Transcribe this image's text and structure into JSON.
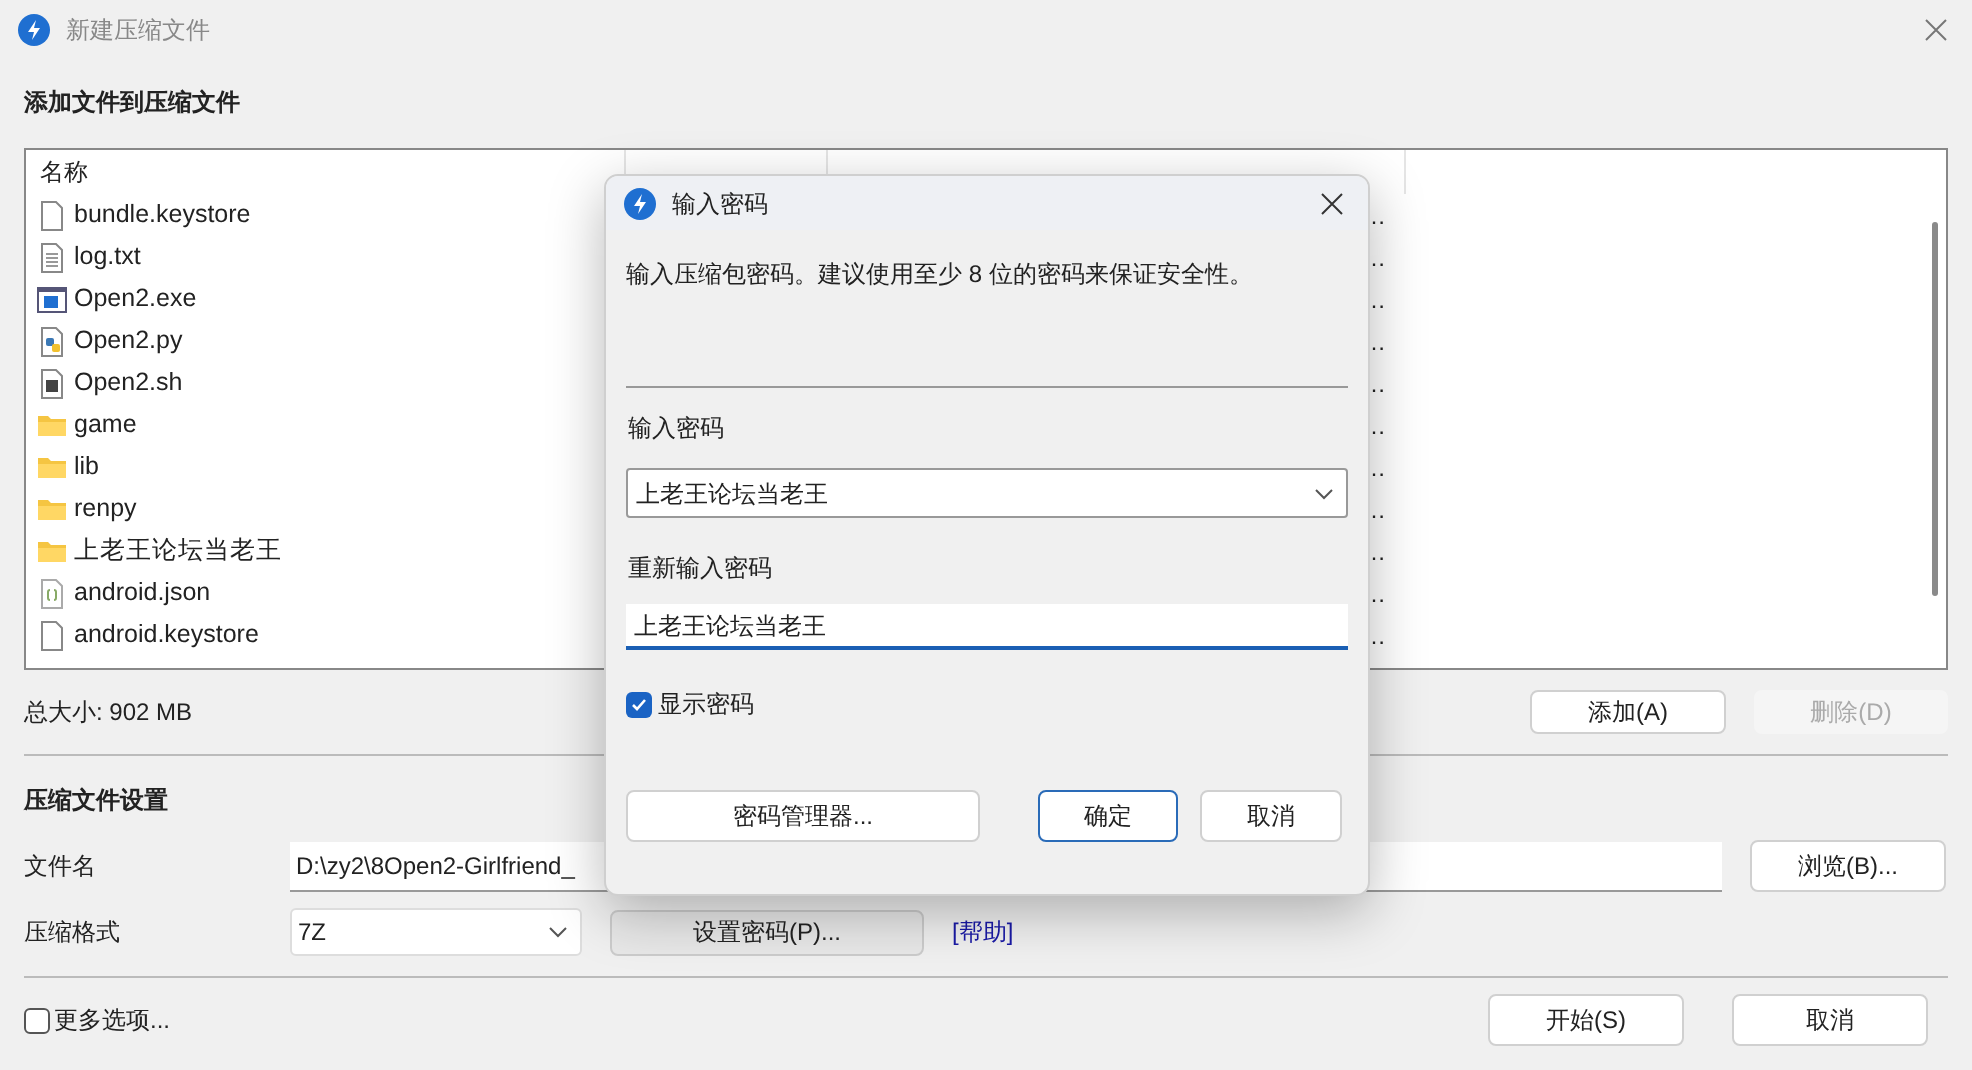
{
  "window": {
    "title": "新建压缩文件"
  },
  "section_files": {
    "title": "添加文件到压缩文件"
  },
  "file_list": {
    "columns": [
      "名称"
    ],
    "rows": [
      {
        "name": "bundle.keystore",
        "kind": "file",
        "path": "…"
      },
      {
        "name": "log.txt",
        "kind": "text",
        "path": "…"
      },
      {
        "name": "Open2.exe",
        "kind": "exe",
        "path": "…"
      },
      {
        "name": "Open2.py",
        "kind": "python",
        "path": "…"
      },
      {
        "name": "Open2.sh",
        "kind": "script",
        "path": "…"
      },
      {
        "name": "game",
        "kind": "folder",
        "path": "…"
      },
      {
        "name": "lib",
        "kind": "folder",
        "path": "…"
      },
      {
        "name": "renpy",
        "kind": "folder",
        "path": "…"
      },
      {
        "name": "上老王论坛当老王",
        "kind": "folder",
        "path": "…"
      },
      {
        "name": "android.json",
        "kind": "json",
        "path": "…"
      },
      {
        "name": "android.keystore",
        "kind": "file",
        "path": "…"
      }
    ]
  },
  "total_size": "总大小: 902 MB",
  "list_buttons": [
    {
      "label": "添加(A)",
      "disabled": false
    },
    {
      "label": "删除(D)",
      "disabled": true
    }
  ],
  "settings": {
    "title": "压缩文件设置",
    "filename_label": "文件名",
    "filename_value": "D:\\zy2\\8Open2-Girlfriend_",
    "browse_button": "浏览(B)...",
    "format_label": "压缩格式",
    "format_value": "7Z",
    "password_button": "设置密码(P)...",
    "help_link": "[帮助]"
  },
  "more_options": {
    "label": "更多选项...",
    "checked": false
  },
  "footer_buttons": [
    "开始(S)",
    "取消"
  ],
  "dialog": {
    "title": "输入密码",
    "message": "输入压缩包密码。建议使用至少 8 位的密码来保证安全性。",
    "password_label": "输入密码",
    "password_value": "上老王论坛当老王",
    "confirm_label": "重新输入密码",
    "confirm_value": "上老王论坛当老王",
    "show_password": {
      "label": "显示密码",
      "checked": true
    },
    "manager_button": "密码管理器...",
    "ok_button": "确定",
    "cancel_button": "取消"
  }
}
